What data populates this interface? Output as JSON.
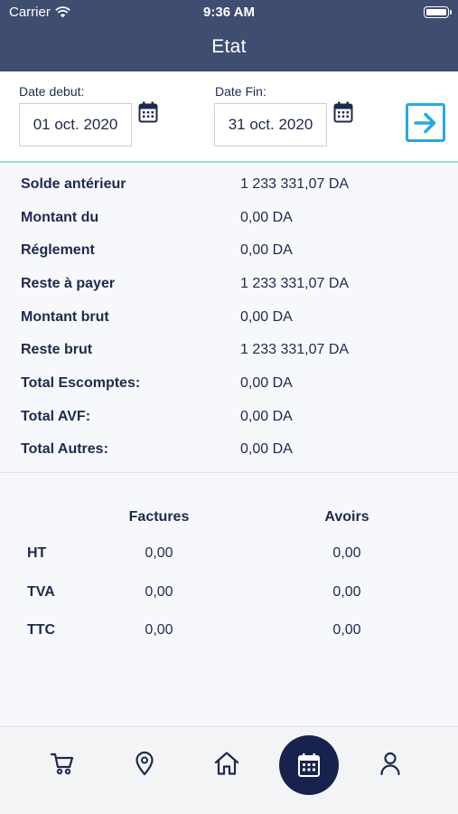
{
  "status": {
    "carrier": "Carrier",
    "time": "9:36 AM"
  },
  "header": {
    "title": "Etat"
  },
  "dates": {
    "start_label": "Date debut:",
    "start_value": "01 oct. 2020",
    "end_label": "Date Fin:",
    "end_value": "31 oct. 2020"
  },
  "summary": [
    {
      "label": "Solde antérieur",
      "value": "1 233 331,07 DA"
    },
    {
      "label": "Montant du",
      "value": "0,00 DA"
    },
    {
      "label": "Réglement",
      "value": "0,00 DA"
    },
    {
      "label": "Reste à payer",
      "value": "1 233 331,07 DA"
    },
    {
      "label": "Montant brut",
      "value": "0,00 DA"
    },
    {
      "label": "Reste brut",
      "value": "1 233 331,07 DA"
    },
    {
      "label": "Total Escomptes:",
      "value": "0,00 DA"
    },
    {
      "label": "Total AVF:",
      "value": "0,00 DA"
    },
    {
      "label": "Total Autres:",
      "value": "0,00 DA"
    }
  ],
  "invoices": {
    "col_factures": "Factures",
    "col_avoirs": "Avoirs",
    "rows": [
      {
        "label": "HT",
        "factures": "0,00",
        "avoirs": "0,00"
      },
      {
        "label": "TVA",
        "factures": "0,00",
        "avoirs": "0,00"
      },
      {
        "label": "TTC",
        "factures": "0,00",
        "avoirs": "0,00"
      }
    ]
  },
  "nav": {
    "items": [
      "cart-icon",
      "location-pin-icon",
      "home-icon",
      "calendar-icon",
      "user-icon"
    ],
    "active": "calendar-icon"
  },
  "colors": {
    "header_bg": "#3f4d70",
    "accent_blue": "#2aa7e3",
    "divider_green": "#9be0c8",
    "nav_active_bg": "#17234d",
    "text_dark": "#1d2a4d"
  }
}
